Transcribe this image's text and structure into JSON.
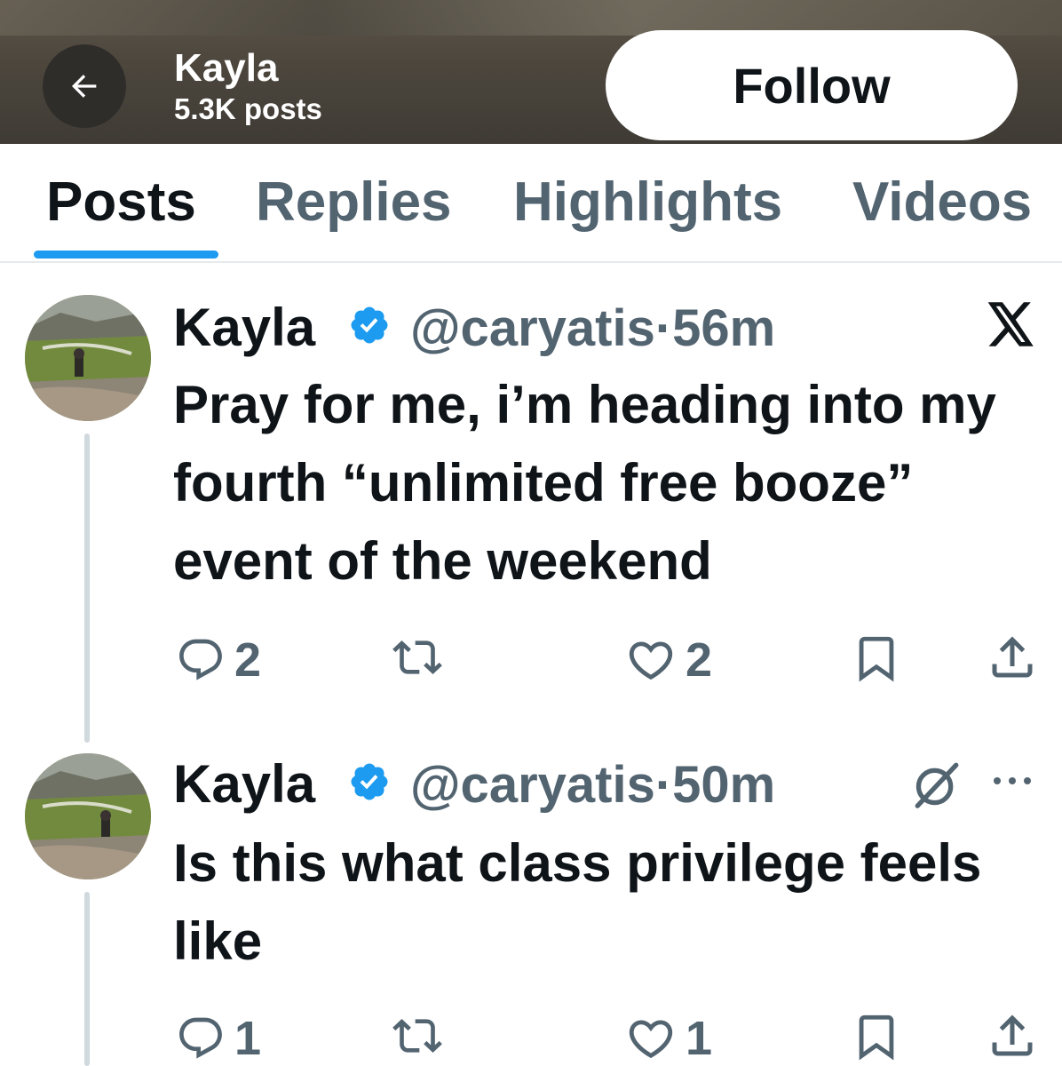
{
  "header": {
    "name": "Kayla",
    "posts_count": "5.3K posts",
    "follow_label": "Follow"
  },
  "tabs": [
    {
      "label": "Posts",
      "active": true
    },
    {
      "label": "Replies"
    },
    {
      "label": "Highlights"
    },
    {
      "label": "Videos"
    }
  ],
  "posts": [
    {
      "author": "Kayla",
      "handle": "@caryatis",
      "time": "·56m",
      "text": "Pray for me, i’m heading into my fourth “unlimited free booze” event of the weekend",
      "reply_count": "2",
      "retweet_count": "",
      "like_count": "2"
    },
    {
      "author": "Kayla",
      "handle": "@caryatis",
      "time": "·50m",
      "text": "Is this what class privilege feels like",
      "reply_count": "1",
      "retweet_count": "",
      "like_count": "1"
    }
  ],
  "colors": {
    "accent": "#1d9bf0",
    "text": "#0f1419",
    "muted": "#536471"
  }
}
